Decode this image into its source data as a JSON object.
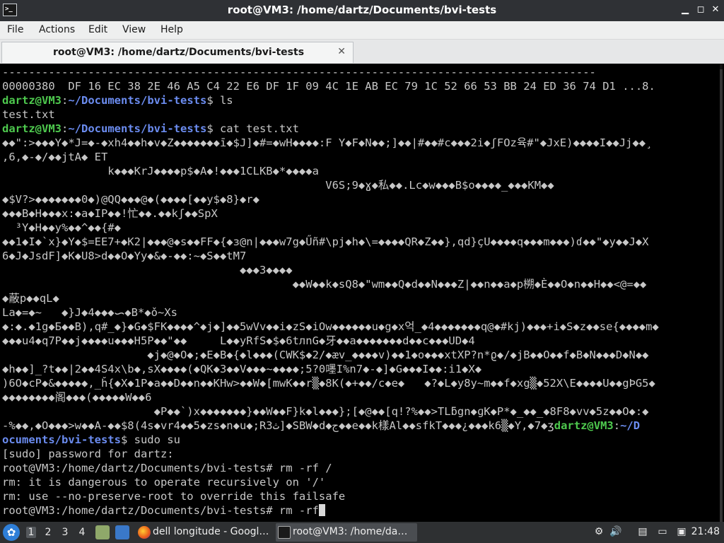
{
  "window": {
    "title": "root@VM3: /home/dartz/Documents/bvi-tests",
    "icon_label": ">_"
  },
  "controls": {
    "minimize": "▁",
    "maximize": "◻",
    "close": "✕"
  },
  "menu": [
    "File",
    "Actions",
    "Edit",
    "View",
    "Help"
  ],
  "tab": {
    "label": "root@VM3: /home/dartz/Documents/bvi-tests",
    "close": "✕"
  },
  "terminal": {
    "lines": [
      [
        {
          "t": "------------------------------------------------------------------------------------------"
        }
      ],
      [
        {
          "t": "00000380  DF 16 EC 38 2E 46 A5 C4 22 E6 DF 1F 09 4C 1E AB EC 79 1C 52 66 53 BB 24 ED 36 74 D1 ...8."
        }
      ],
      [
        {
          "t": "dartz@VM3",
          "c": "u"
        },
        {
          "t": ":"
        },
        {
          "t": "~/Documents/bvi-tests",
          "c": "p"
        },
        {
          "t": "$ ls"
        }
      ],
      [
        {
          "t": "test.txt"
        }
      ],
      [
        {
          "t": "dartz@VM3",
          "c": "u"
        },
        {
          "t": ":"
        },
        {
          "t": "~/Documents/bvi-tests",
          "c": "p"
        },
        {
          "t": "$ cat test.txt"
        }
      ],
      [
        {
          "t": "◆◆\":>◆◆◆Y◆*J=◆-◆xh4◆◆h◆v◆Z◆◆◆◆◆◆◆ī◆$J]◆#=◆wH◆◆◆◆:F Y◆F◆N◆◆;]◆◆|#◆◆#c◆◆◆2i◆ʃFOz육#\"◆JxE)◆◆◆◆I◆◆Jj◆◆¸"
        }
      ],
      [
        {
          "t": ",6,◆-◆/◆◆jtA◆ ET"
        }
      ],
      [
        {
          "t": "                k◆◆◆KrJ◆◆◆◆p$◆A◆!◆◆◆1CLKB◆*◆◆◆◆a"
        }
      ],
      [
        {
          "t": "                                                 V6S;9◆ɣ◆私◆◆.Lc◆w◆◆◆B$o◆◆◆◆_◆◆◆KM◆◆"
        }
      ],
      [
        {
          "t": "◆$V?>◆◆◆◆◆◆◆0◆)@QQ◆◆◆@◆(◆◆◆◆[◆◆y$◆8}◆r◆"
        }
      ],
      [
        {
          "t": "◆◆◆B◆H◆◆◆x:◆a◆IP◆◆!忙◆◆.◆◆kʃ◆◆SpX"
        }
      ],
      [
        {
          "t": "  ³Y◆H◆◆y%◆◆^◆◆{#◆"
        }
      ],
      [
        {
          "t": "◆◆1◆I◆`x}◆Y◆$=EE7+◆K2|◆◆◆@◆s◆◆FF◆{◆ɜ@n|◆◆◆w7g◆Űñ#\\pj◆h◆\\=◆◆◆◆QR◆Z◆◆},qd}çU◆◆◆◆q◆◆◆m◆◆◆)ɗ◆◆\"◆y◆◆J◆X"
        }
      ],
      [
        {
          "t": "6◆J◆JsdF]◆K◆U8>d◆◆O◆Yy◆&◆-◆◆:~◆S◆◆tM7"
        }
      ],
      [
        {
          "t": "                                    ◆◆◆3◆◆◆◆"
        }
      ],
      [
        {
          "t": "                                            ◆◆W◆◆k◆sQ8◆\"wm◆◆Q◆d◆◆N◆◆◆Z|◆◆n◆◆a◆p㮶◆È◆◆O◆n◆◆H◆◆<@=◆◆"
        }
      ],
      [
        {
          "t": "◆蔽p◆◆qL◆"
        }
      ],
      [
        {
          "t": "La◆=◆~   ◆}J◆4◆◆◆ᯈ◆B*◆ǒ~Xs"
        }
      ],
      [
        {
          "t": "◆:◆.◆1g◆Б◆◆B),q#_◆}◆G◆$FK◆◆◆◆^◆j◆]◆◆5wVv◆◆i◆zS◆iOw◆◆◆◆◆◆u◆g◆x억_◆4◆◆◆◆◆◆◆q@◆#kj)◆◆◆+i◆S◆z◆◆se{◆◆◆◆m◆"
        }
      ],
      [
        {
          "t": "◆◆◆u4◆q7P◆◆j◆◆◆◆u◆◆◆H5P◆◆\"◆◆     L◆◆yRfS◆$◆6tлnG◆牙◆◆a◆◆◆◆◆◆◆d◆◆c◆◆◆UD◆4"
        }
      ],
      [
        {
          "t": "                      ◆j◆@◆O◆;◆E◆B◆{◆l◆◆◆(CWK$◆2/◆æv_◆◆◆◆v)◆◆1◆o◆◆◆xtXP?n*ϱ◆/◆jB◆◆O◆◆f◆B◆N◆◆◆D◆N◆◆"
        }
      ],
      [
        {
          "t": "◆h◆◆]_?t◆◆|2◆◆4S4x\\b◆,sX◆◆◆◆(◆QK◆3◆◆V◆◆◆~◆◆◆◆;5?0嚜I%n7◆-◆]◆G◆◆◆I◆◆:i1◆X◆"
        }
      ],
      [
        {
          "t": ")6O◆cP◆&◆◆◆◆◆,_ȟ{◆X◆1P◆a◆◆D◆◆n◆◆KHw>◆◆W◆[mwK◆◆r▒◆8K(◆+◆◆/c◆e◆   ◆?◆L◆y8y~m◆◆f◆xg▒◆52X\\E◆◆◆◆U◆◆gÞG5◆"
        }
      ],
      [
        {
          "t": "◆◆◆◆◆◆◆◆阁◆◆◆(◆◆◆◆◆W◆◆6"
        }
      ],
      [
        {
          "t": "                       ◆P◆◆`)x◆◆◆◆◆◆◆}◆◆W◆◆F}k◆l◆◆◆};[◆@◆◆[q!?%◆◆>TLƃgn◆ɡK◆P*◆_◆◆_◆8F8◆vv◆5z◆◆O◆:◆"
        }
      ],
      [
        {
          "t": "-%◆◆,◆O◆◆◆>w◆◆A-◆◆$8(4s◆vr4◆◆5◆zs◆n◆u◆;R3ث]◆SBW◆d◆ج◆◆e◆◆k樣Al◆◆sfkT◆◆◆¿◆◆◆k6▒◆Y,◆7◆ʒ"
        },
        {
          "t": "dartz@VM3",
          "c": "u"
        },
        {
          "t": ":"
        },
        {
          "t": "~/D",
          "c": "p"
        }
      ],
      [
        {
          "t": "ocuments/bvi-tests",
          "c": "p"
        },
        {
          "t": "$ sudo su"
        }
      ],
      [
        {
          "t": "[sudo] password for dartz:"
        }
      ],
      [
        {
          "t": "root@VM3:/home/dartz/Documents/bvi-tests# rm -rf /"
        }
      ],
      [
        {
          "t": "rm: it is dangerous to operate recursively on '/'"
        }
      ],
      [
        {
          "t": "rm: use --no-preserve-root to override this failsafe"
        }
      ],
      [
        {
          "t": "root@VM3:/home/dartz/Documents/bvi-tests# rm -rf"
        }
      ]
    ]
  },
  "taskbar": {
    "workspaces": [
      "1",
      "2",
      "3",
      "4"
    ],
    "active_workspace": "1",
    "tasks": [
      {
        "label": "dell longitude - Googl…",
        "icon": "firefox-icon",
        "active": false
      },
      {
        "label": "root@VM3: /home/da…",
        "icon": "terminal-icon",
        "active": true
      }
    ],
    "clock": "21:48"
  },
  "colors": {
    "titlebar": "#2f3135",
    "menubar": "#eeefef",
    "terminal_bg": "#000000",
    "prompt_user": "#4ec94e",
    "prompt_path": "#6b8cf0",
    "taskbar": "#2e3032"
  }
}
